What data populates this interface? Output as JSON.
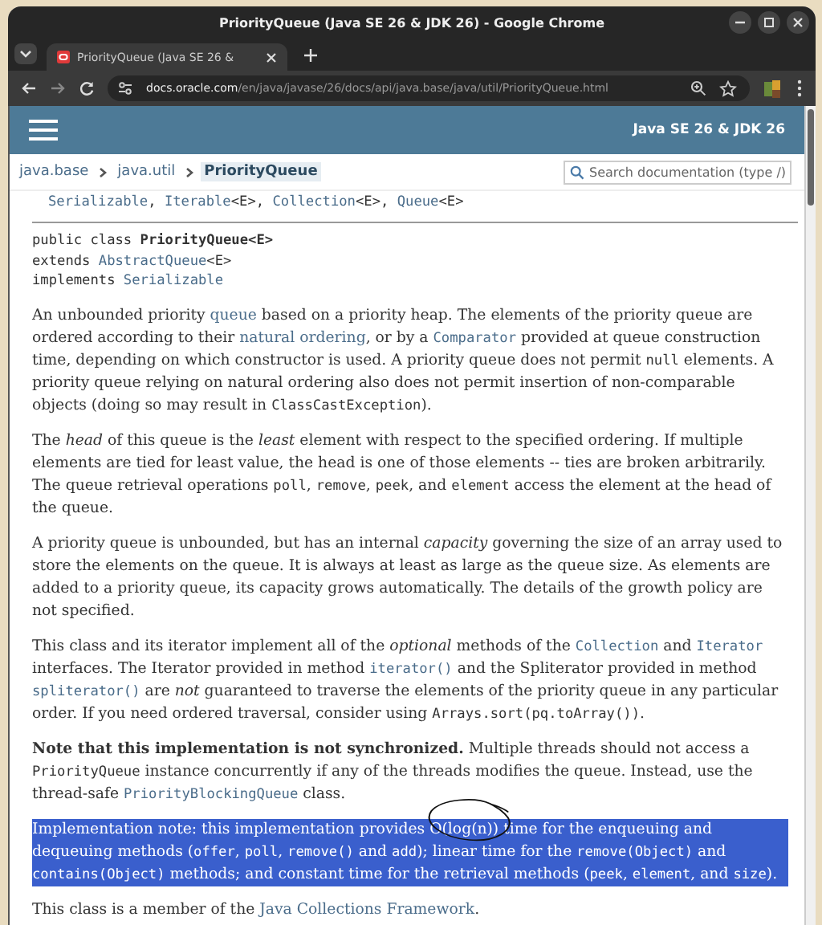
{
  "window": {
    "title": "PriorityQueue (Java SE 26 & JDK 26) - Google Chrome"
  },
  "tabs": [
    {
      "title": "PriorityQueue (Java SE 26 &",
      "selected": true
    }
  ],
  "url": {
    "host": "docs.oracle.com",
    "path": "/en/java/javase/26/docs/api/java.base/java/util/PriorityQueue.html"
  },
  "header": {
    "version": "Java SE 26 & JDK 26"
  },
  "breadcrumb": [
    {
      "label": "java.base",
      "selected": false
    },
    {
      "label": "java.util",
      "selected": false
    },
    {
      "label": "PriorityQueue",
      "selected": true
    }
  ],
  "search": {
    "placeholder": "Search documentation (type /)"
  },
  "interfaces_line": [
    {
      "kind": "link",
      "text": "Serializable"
    },
    {
      "kind": "text",
      "text": ", "
    },
    {
      "kind": "link",
      "text": "Iterable"
    },
    {
      "kind": "text",
      "text": "<E>, "
    },
    {
      "kind": "link",
      "text": "Collection"
    },
    {
      "kind": "text",
      "text": "<E>, "
    },
    {
      "kind": "link",
      "text": "Queue"
    },
    {
      "kind": "text",
      "text": "<E>"
    }
  ],
  "signature": [
    [
      {
        "kind": "text",
        "text": "public class "
      },
      {
        "kind": "bold",
        "text": "PriorityQueue<E>"
      }
    ],
    [
      {
        "kind": "text",
        "text": "extends "
      },
      {
        "kind": "link",
        "text": "AbstractQueue"
      },
      {
        "kind": "text",
        "text": "<E>"
      }
    ],
    [
      {
        "kind": "text",
        "text": "implements "
      },
      {
        "kind": "link",
        "text": "Serializable"
      }
    ]
  ],
  "paragraphs": [
    {
      "selected": false,
      "segments": [
        {
          "kind": "text",
          "text": "An unbounded priority "
        },
        {
          "kind": "link",
          "text": "queue"
        },
        {
          "kind": "text",
          "text": " based on a priority heap. The elements of the priority queue are ordered according to their "
        },
        {
          "kind": "link",
          "text": "natural ordering"
        },
        {
          "kind": "text",
          "text": ", or by a "
        },
        {
          "kind": "codelink",
          "text": "Comparator"
        },
        {
          "kind": "text",
          "text": " provided at queue construction time, depending on which constructor is used. A priority queue does not permit "
        },
        {
          "kind": "code",
          "text": "null"
        },
        {
          "kind": "text",
          "text": " elements. A priority queue relying on natural ordering also does not permit insertion of non-comparable objects (doing so may result in "
        },
        {
          "kind": "code",
          "text": "ClassCastException"
        },
        {
          "kind": "text",
          "text": ")."
        }
      ]
    },
    {
      "selected": false,
      "segments": [
        {
          "kind": "text",
          "text": "The *head* of this queue is the *least* element with respect to the specified ordering. If multiple elements are tied for least value, the head is one of those elements -- ties are broken arbitrarily. The queue retrieval operations "
        },
        {
          "kind": "code",
          "text": "poll"
        },
        {
          "kind": "text",
          "text": ", "
        },
        {
          "kind": "code",
          "text": "remove"
        },
        {
          "kind": "text",
          "text": ", "
        },
        {
          "kind": "code",
          "text": "peek"
        },
        {
          "kind": "text",
          "text": ", and "
        },
        {
          "kind": "code",
          "text": "element"
        },
        {
          "kind": "text",
          "text": " access the element at the head of the queue."
        }
      ]
    },
    {
      "selected": false,
      "segments": [
        {
          "kind": "text",
          "text": "A priority queue is unbounded, but has an internal *capacity* governing the size of an array used to store the elements on the queue. It is always at least as large as the queue size. As elements are added to a priority queue, its capacity grows automatically. The details of the growth policy are not specified."
        }
      ]
    },
    {
      "selected": false,
      "segments": [
        {
          "kind": "text",
          "text": "This class and its iterator implement all of the *optional* methods of the "
        },
        {
          "kind": "codelink",
          "text": "Collection"
        },
        {
          "kind": "text",
          "text": " and "
        },
        {
          "kind": "codelink",
          "text": "Iterator"
        },
        {
          "kind": "text",
          "text": " interfaces. The Iterator provided in method "
        },
        {
          "kind": "codelink",
          "text": "iterator()"
        },
        {
          "kind": "text",
          "text": " and the Spliterator provided in method "
        },
        {
          "kind": "codelink",
          "text": "spliterator()"
        },
        {
          "kind": "text",
          "text": " are *not* guaranteed to traverse the elements of the priority queue in any particular order. If you need ordered traversal, consider using "
        },
        {
          "kind": "code",
          "text": "Arrays.sort(pq.toArray())"
        },
        {
          "kind": "text",
          "text": "."
        }
      ]
    },
    {
      "selected": false,
      "segments": [
        {
          "kind": "text",
          "text": "**Note that this implementation is not synchronized.** Multiple threads should not access a "
        },
        {
          "kind": "code",
          "text": "PriorityQueue"
        },
        {
          "kind": "text",
          "text": " instance concurrently if any of the threads modifies the queue. Instead, use the thread-safe "
        },
        {
          "kind": "codelink",
          "text": "PriorityBlockingQueue"
        },
        {
          "kind": "text",
          "text": " class."
        }
      ]
    },
    {
      "selected": true,
      "circled": true,
      "segments": [
        {
          "kind": "text",
          "text": "Implementation note: this implementation provides O(log(n)) time for the enqueuing and dequeuing methods ("
        },
        {
          "kind": "code",
          "text": "offer"
        },
        {
          "kind": "text",
          "text": ", "
        },
        {
          "kind": "code",
          "text": "poll"
        },
        {
          "kind": "text",
          "text": ", "
        },
        {
          "kind": "code",
          "text": "remove()"
        },
        {
          "kind": "text",
          "text": " and "
        },
        {
          "kind": "code",
          "text": "add"
        },
        {
          "kind": "text",
          "text": "); linear time for the "
        },
        {
          "kind": "code",
          "text": "remove(Object)"
        },
        {
          "kind": "text",
          "text": " and "
        },
        {
          "kind": "code",
          "text": "contains(Object)"
        },
        {
          "kind": "text",
          "text": " methods; and constant time for the retrieval methods ("
        },
        {
          "kind": "code",
          "text": "peek"
        },
        {
          "kind": "text",
          "text": ", "
        },
        {
          "kind": "code",
          "text": "element"
        },
        {
          "kind": "text",
          "text": ", and "
        },
        {
          "kind": "code",
          "text": "size"
        },
        {
          "kind": "text",
          "text": ")."
        }
      ]
    },
    {
      "selected": false,
      "segments": [
        {
          "kind": "text",
          "text": "This class is a member of the "
        },
        {
          "kind": "link",
          "text": "Java Collections Framework"
        },
        {
          "kind": "text",
          "text": "."
        }
      ]
    }
  ]
}
